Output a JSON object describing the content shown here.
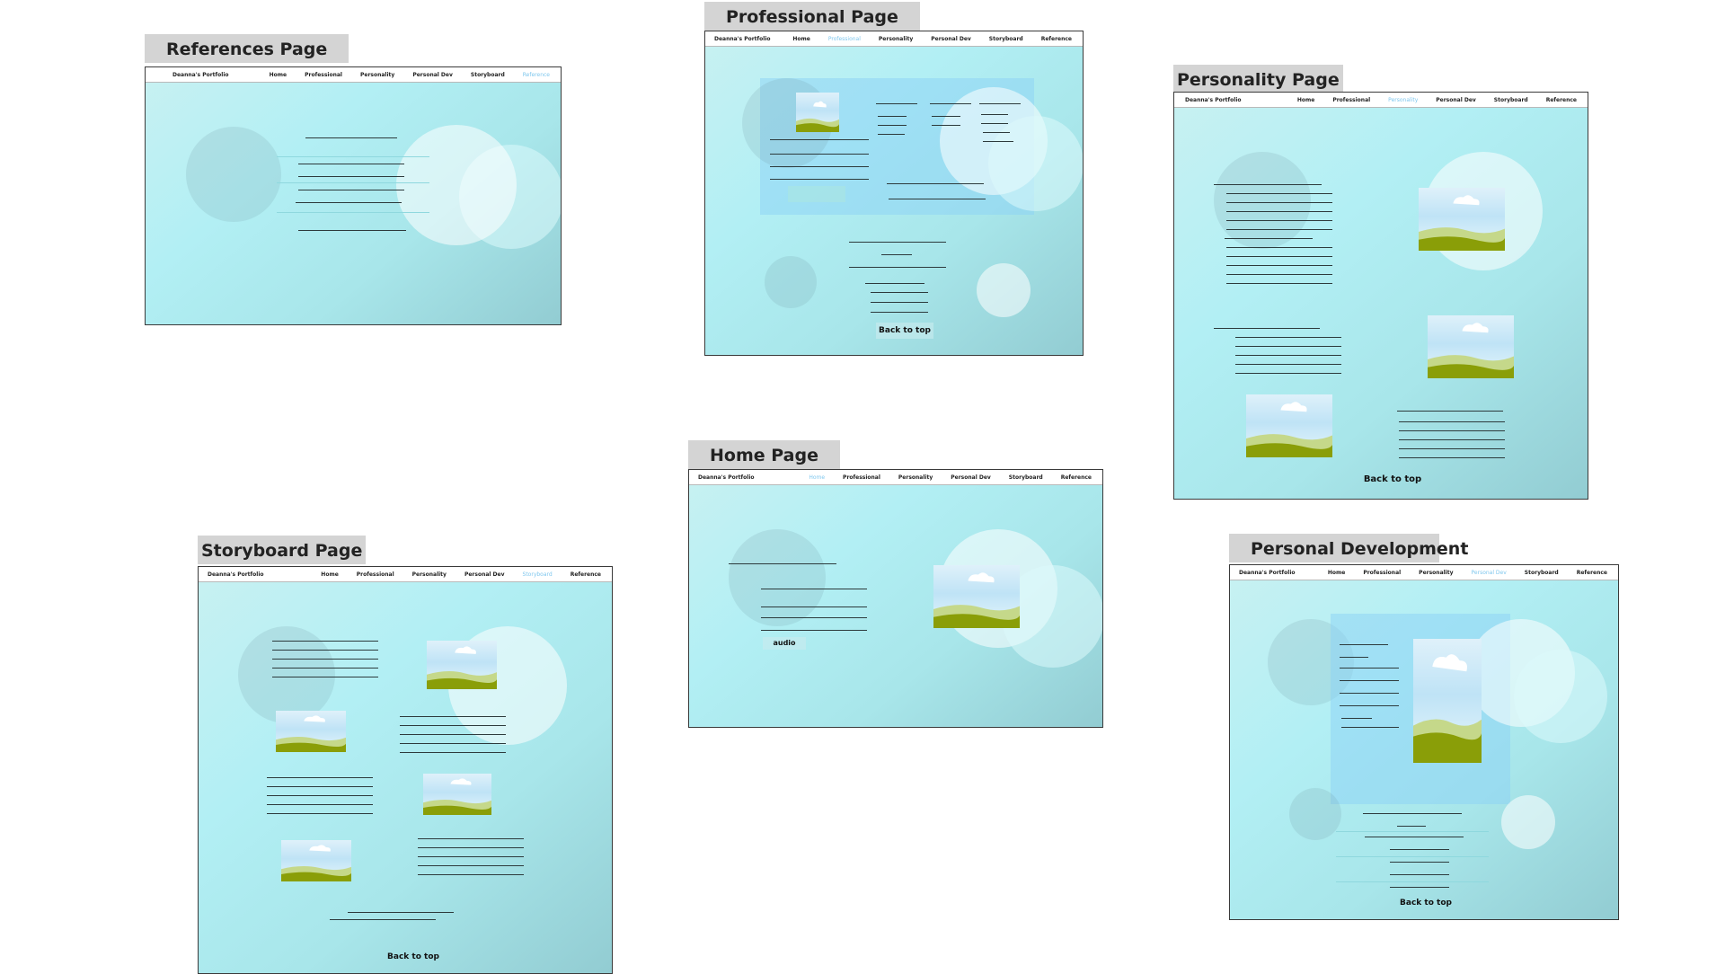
{
  "boards": {
    "references": {
      "title": "References Page",
      "nav": {
        "brand": "Deanna's Portfolio",
        "links": [
          "Home",
          "Professional",
          "Personality",
          "Personal Dev",
          "Storyboard",
          "Reference"
        ],
        "active": "Reference"
      }
    },
    "professional": {
      "title": "Professional  Page",
      "nav": {
        "brand": "Deanna's Portfolio",
        "links": [
          "Home",
          "Professional",
          "Personality",
          "Personal Dev",
          "Storyboard",
          "Reference"
        ],
        "active": "Professional"
      },
      "back_to_top": "Back to top"
    },
    "personality": {
      "title": "Personality Page",
      "nav": {
        "brand": "Deanna's Portfolio",
        "links": [
          "Home",
          "Professional",
          "Personality",
          "Personal Dev",
          "Storyboard",
          "Reference"
        ],
        "active": "Personality"
      },
      "back_to_top": "Back to top"
    },
    "home": {
      "title": "Home Page",
      "nav": {
        "brand": "Deanna's Portfolio",
        "links": [
          "Home",
          "Professional",
          "Personality",
          "Personal Dev",
          "Storyboard",
          "Reference"
        ],
        "active": "Home"
      },
      "audio": "audio"
    },
    "storyboard": {
      "title": "Storyboard Page",
      "nav": {
        "brand": "Deanna's Portfolio",
        "links": [
          "Home",
          "Professional",
          "Personality",
          "Personal Dev",
          "Storyboard",
          "Reference"
        ],
        "active": "Storyboard"
      },
      "back_to_top": "Back to top"
    },
    "personal_dev": {
      "title": "Personal Development",
      "nav": {
        "brand": "Deanna's Portfolio",
        "links": [
          "Home",
          "Professional",
          "Personality",
          "Personal Dev",
          "Storyboard",
          "Reference"
        ],
        "active": "Personal Dev"
      },
      "back_to_top": "Back to top"
    }
  },
  "colors": {
    "tag_background": "#d4d4d4",
    "active_link": "#7fc7ee",
    "image_grass": "#8a9e08",
    "image_sky": "#cfeaf8"
  },
  "icons": [
    "landscape-image-icon"
  ]
}
